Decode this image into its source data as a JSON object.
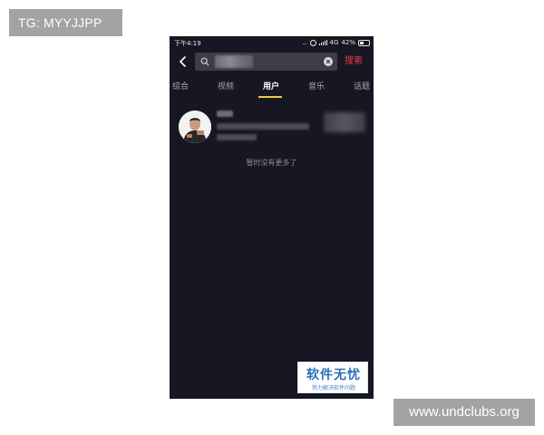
{
  "watermarks": {
    "top_left": "TG: MYYJJPP",
    "bottom_right": "www.undclubs.org"
  },
  "status_bar": {
    "time": "下午4:19",
    "dots": "...",
    "network": "4G",
    "battery": "42%"
  },
  "search": {
    "query": "抖",
    "submit_label": "搜索"
  },
  "tabs": [
    {
      "label": "综合",
      "active": false
    },
    {
      "label": "视频",
      "active": false
    },
    {
      "label": "用户",
      "active": true
    },
    {
      "label": "音乐",
      "active": false
    },
    {
      "label": "话题",
      "active": false
    }
  ],
  "result": {
    "name": "抖音",
    "subtitle": "粉丝",
    "id": "抖音号"
  },
  "empty_message": "暂时没有更多了",
  "logo": {
    "title": "软件无忧",
    "subtitle": "努力解决软件问题"
  },
  "colors": {
    "background": "#161722",
    "accent": "#f23a5c",
    "tab_indicator": "#f2c94c",
    "search_box": "#3c3d47"
  },
  "icons": [
    "back-icon",
    "search-icon",
    "clear-icon",
    "alarm-icon",
    "signal-icon",
    "battery-icon"
  ]
}
